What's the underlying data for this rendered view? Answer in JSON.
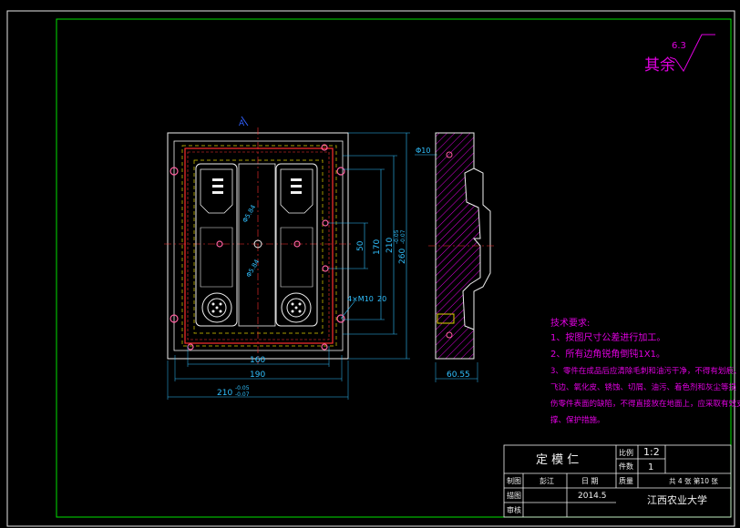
{
  "roughness": {
    "label": "其余",
    "value": "6.3"
  },
  "dimensions": {
    "d160": "160",
    "d190": "190",
    "d210": "210",
    "d210_tol_upper": "-0.05",
    "d210_tol_lower": "-0.07",
    "d170": "170",
    "d210v": "210",
    "d260": "260",
    "d260_tol_upper": "-0.05",
    "d260_tol_lower": "-0.07",
    "d50": "50",
    "phi10": "Φ10",
    "holes": "4×M10",
    "depth": "20",
    "phi584a": "Φ5.84",
    "phi584b": "Φ5.84",
    "d6055": "60.55"
  },
  "notes": {
    "title": "技术要求:",
    "lines": [
      "1、按图尺寸公差进行加工。",
      "2、所有边角锐角倒钝1X1。",
      "3、零件在成品后应清除毛刺和油污干净，不得有划痕、",
      "飞边、氧化皮、锈蚀、切屑、油污、着色剂和灰尘等损",
      "伤零件表面的缺陷，不得直接放在地面上，应采取有效支",
      "撑、保护措施。"
    ]
  },
  "title_block": {
    "part_name": "定 模 仁",
    "scale_label": "比例",
    "scale_value": "1:2",
    "qty_label": "件数",
    "qty_value": "1",
    "design_label": "制图",
    "designer": "彭江",
    "date_label": "日 期",
    "date_value": "2014.5",
    "weight_label": "质量",
    "sheets": "共 4 张  第10 张",
    "check_label": "描图",
    "review_label": "审核",
    "school": "江西农业大学"
  }
}
